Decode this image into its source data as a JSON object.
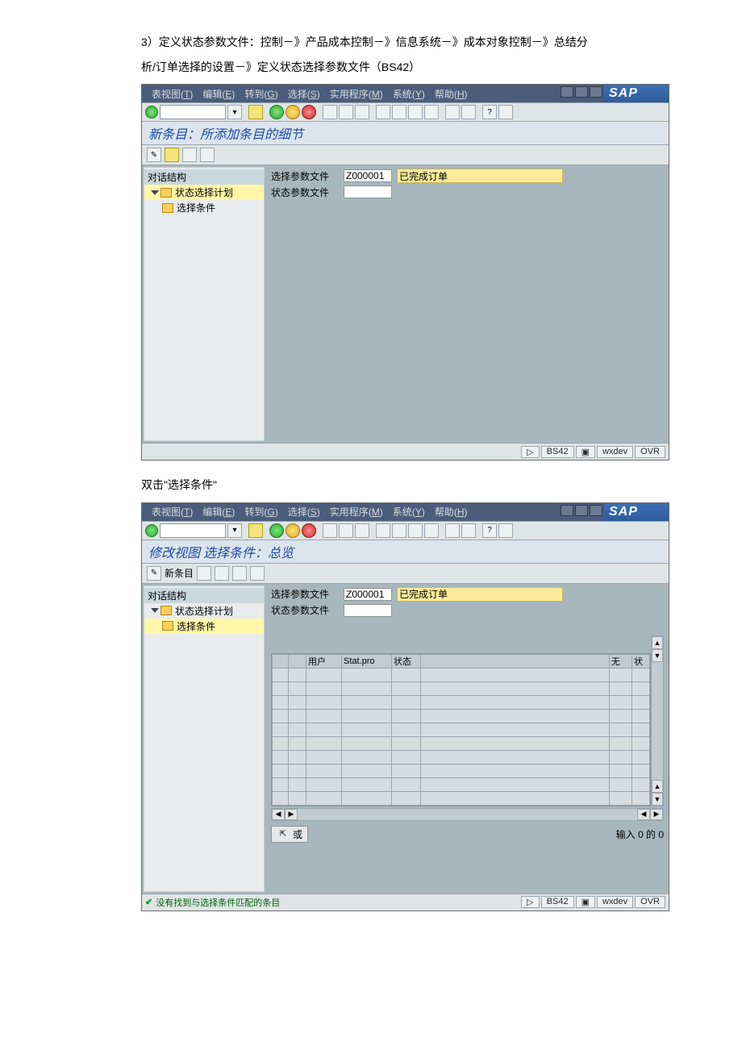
{
  "doc": {
    "p1a": "3）定义状态参数文件：控制－》产品成本控制－》信息系统－》成本对象控制－》总结分",
    "p1b": "析/订单选择的设置－》定义状态选择参数文件（BS42）",
    "p2": "双击\"选择条件\""
  },
  "menu": {
    "items": [
      {
        "label": "表视图",
        "key": "T"
      },
      {
        "label": "编辑",
        "key": "E"
      },
      {
        "label": "转到",
        "key": "G"
      },
      {
        "label": "选择",
        "key": "S"
      },
      {
        "label": "实用程序",
        "key": "M"
      },
      {
        "label": "系统",
        "key": "Y"
      },
      {
        "label": "帮助",
        "key": "H"
      }
    ],
    "logo": "SAP"
  },
  "screen1": {
    "heading": "新条目：所添加条目的细节",
    "tree": {
      "header": "对话结构",
      "node": "状态选择计划",
      "leaf": "选择条件"
    },
    "fields": {
      "f1_label": "选择参数文件",
      "f1_value": "Z000001",
      "f1_desc": "已完成订单",
      "f2_label": "状态参数文件"
    },
    "status": {
      "tcode": "BS42",
      "server": "wxdev",
      "mode": "OVR"
    }
  },
  "screen2": {
    "heading": "修改视图 选择条件：总览",
    "app_toolbar": {
      "new_entry": "新条目"
    },
    "tree": {
      "header": "对话结构",
      "node": "状态选择计划",
      "leaf": "选择条件"
    },
    "fields": {
      "f1_label": "选择参数文件",
      "f1_value": "Z000001",
      "f1_desc": "已完成订单",
      "f2_label": "状态参数文件"
    },
    "table": {
      "cols": [
        "",
        "用户",
        "Stat.pro",
        "状态",
        "",
        "无",
        "状"
      ]
    },
    "footer": {
      "or": "或",
      "entries": "输入 0 的 0"
    },
    "status": {
      "msg": "没有找到与选择条件匹配的条目",
      "tcode": "BS42",
      "server": "wxdev",
      "mode": "OVR"
    }
  }
}
